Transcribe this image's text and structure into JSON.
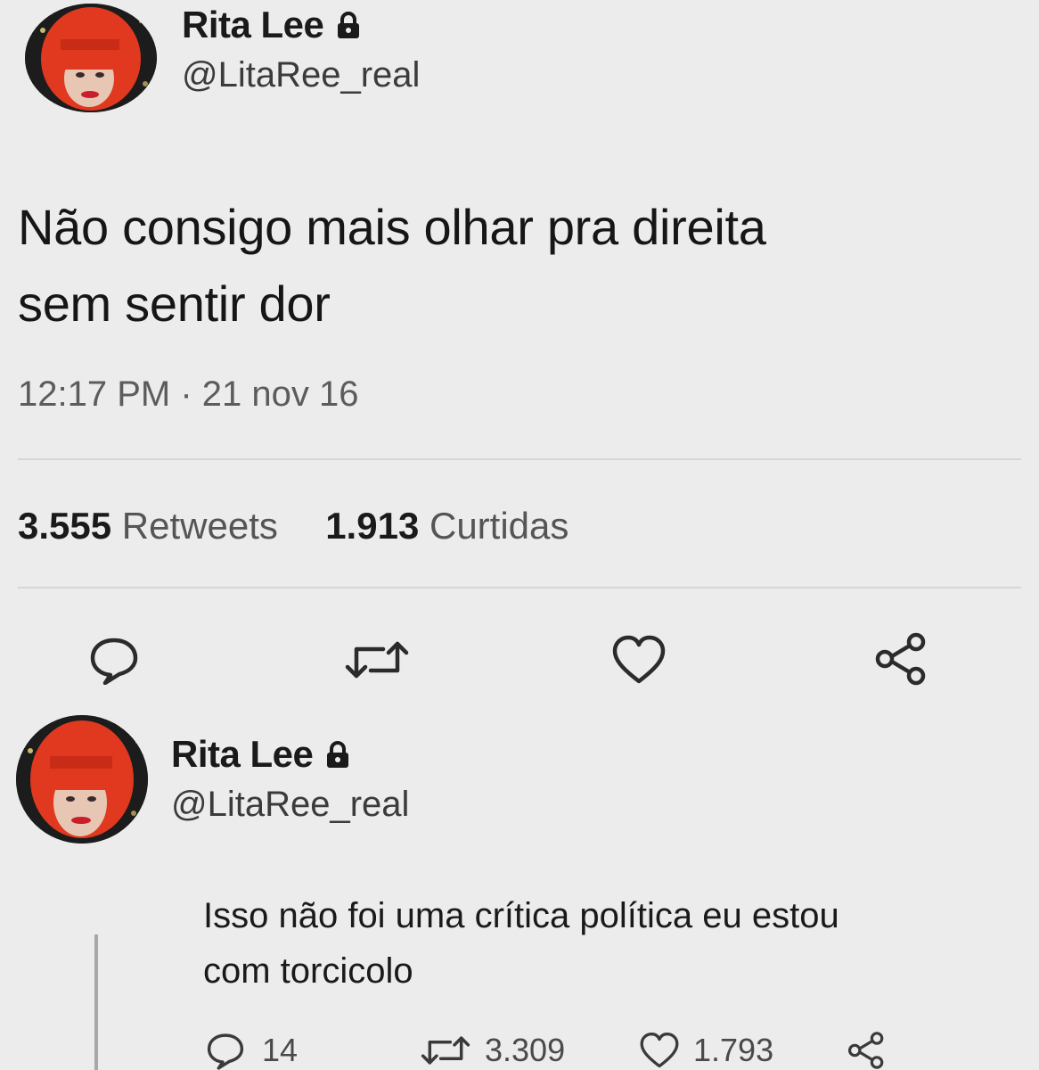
{
  "tweet": {
    "author_name": "Rita Lee",
    "author_handle": "@LitaRee_real",
    "text_line1": "Não consigo mais olhar pra direita",
    "text_line2": "sem sentir dor",
    "time": "12:17 PM",
    "separator": "·",
    "date": "21 nov 16",
    "retweets_count": "3.555",
    "retweets_label": "Retweets",
    "likes_count": "1.913",
    "likes_label": "Curtidas"
  },
  "reply": {
    "author_name": "Rita Lee",
    "author_handle": "@LitaRee_real",
    "text_line1": "Isso não foi uma crítica política eu estou",
    "text_line2": "com torcicolo",
    "reply_count": "14",
    "retweet_count": "3.309",
    "like_count": "1.793"
  },
  "icons": {
    "reply": "reply-bubble-icon",
    "retweet": "retweet-icon",
    "like": "heart-icon",
    "share": "share-icon",
    "lock": "lock-icon"
  },
  "colors": {
    "background": "#ececec",
    "text": "#1a1a1a",
    "muted": "#5c5c5c",
    "avatar_hair": "#e0391f"
  }
}
